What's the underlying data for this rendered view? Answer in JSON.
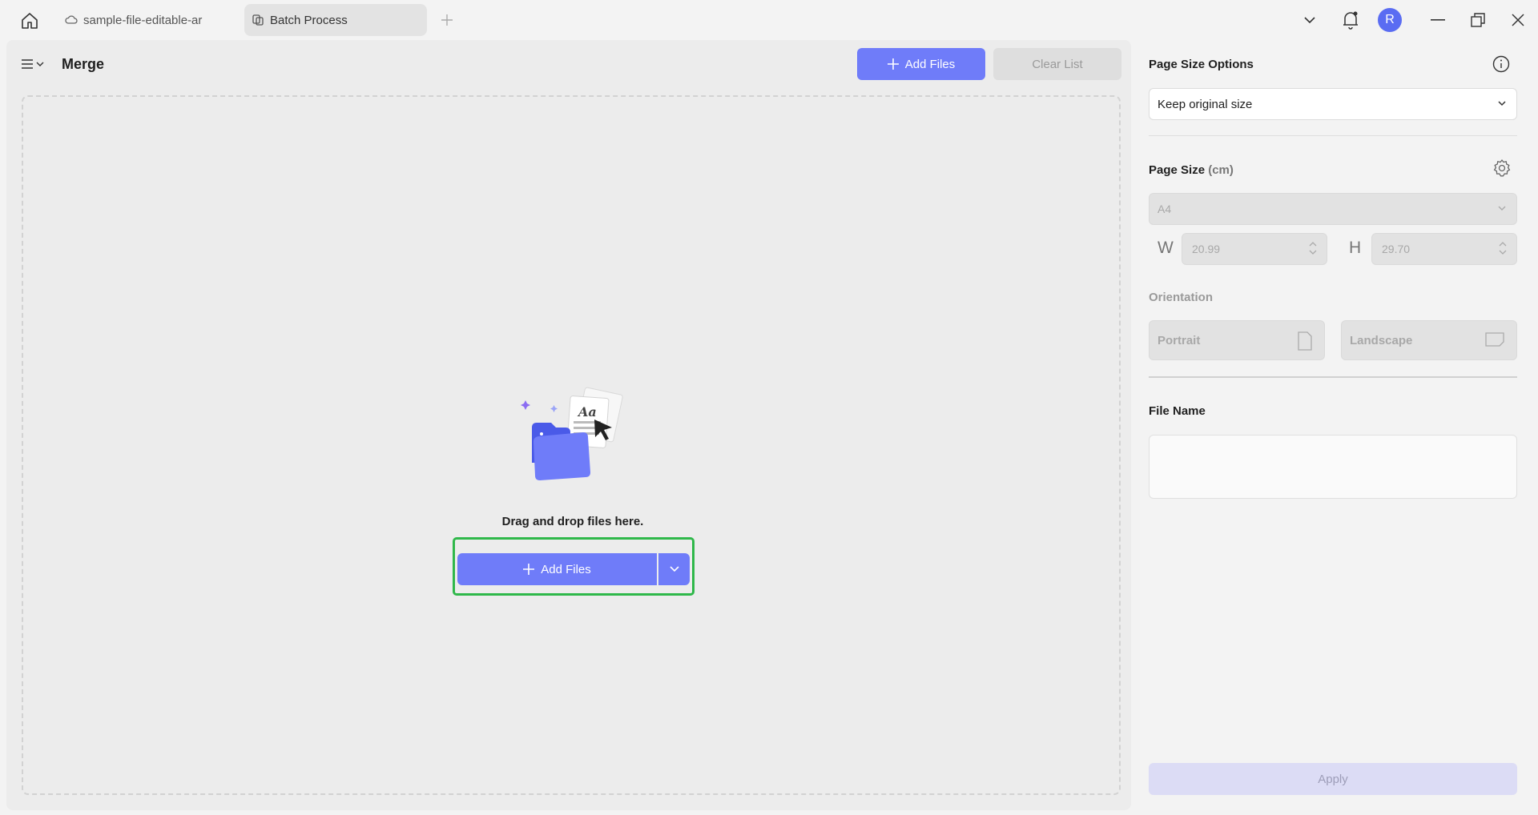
{
  "titlebar": {
    "tabs": [
      {
        "label": "sample-file-editable-ar",
        "icon": "cloud-icon"
      },
      {
        "label": "Batch Process",
        "icon": "batch-icon"
      }
    ],
    "avatar_initial": "R"
  },
  "main": {
    "title": "Merge",
    "add_files_label": "Add Files",
    "clear_list_label": "Clear List",
    "drop_text": "Drag and drop files here.",
    "add_files_main_label": "Add Files"
  },
  "side": {
    "page_size_options_title": "Page Size Options",
    "page_size_option_selected": "Keep original size",
    "page_size_title": "Page Size",
    "page_size_unit": "(cm)",
    "paper_size_selected": "A4",
    "width_label": "W",
    "width_value": "20.99",
    "height_label": "H",
    "height_value": "29.70",
    "orientation_title": "Orientation",
    "portrait_label": "Portrait",
    "landscape_label": "Landscape",
    "file_name_title": "File Name",
    "file_name_value": "",
    "apply_label": "Apply"
  },
  "colors": {
    "accent": "#6f7cf9",
    "highlight": "#2fb84a",
    "avatar": "#5a6cf2"
  }
}
